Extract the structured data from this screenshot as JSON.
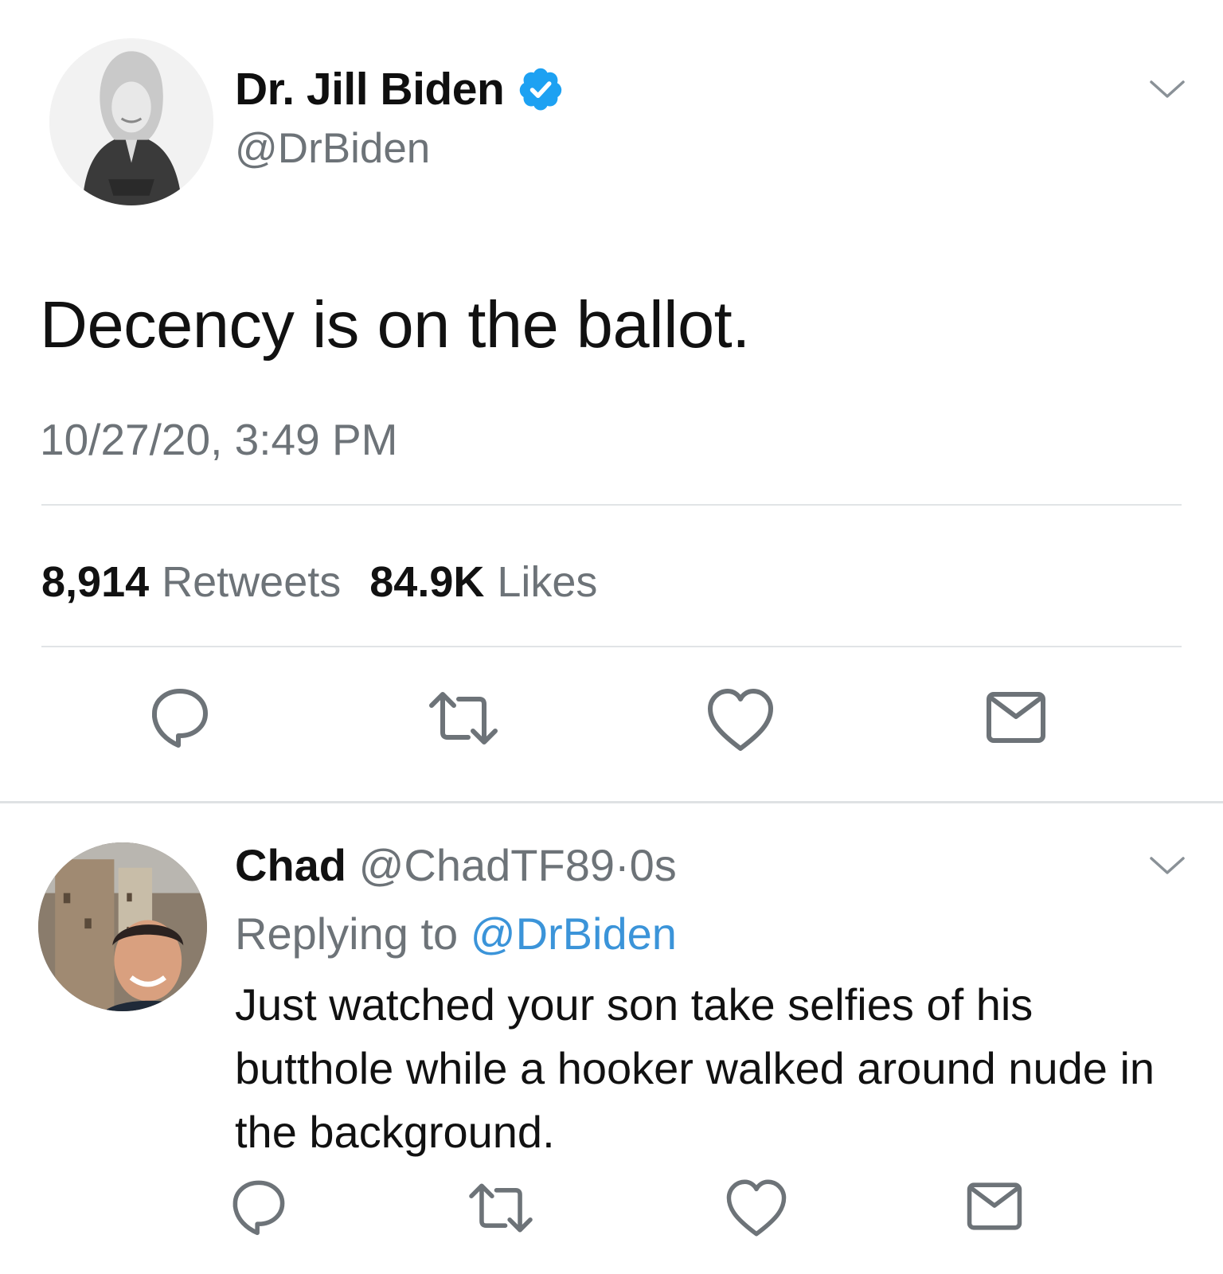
{
  "tweet": {
    "author_name": "Dr. Jill Biden",
    "author_handle": "@DrBiden",
    "verified": true,
    "text": "Decency is on the ballot.",
    "timestamp": "10/27/20, 3:49 PM",
    "retweets_count": "8,914",
    "retweets_label": "Retweets",
    "likes_count": "84.9K",
    "likes_label": "Likes",
    "actions": [
      "reply-icon",
      "retweet-icon",
      "like-icon",
      "message-icon"
    ]
  },
  "reply": {
    "author_name": "Chad",
    "author_handle": "@ChadTF89",
    "separator": "·",
    "time": "0s",
    "replying_prefix": "Replying to",
    "replying_to": "@DrBiden",
    "text": "Just watched your son take selfies of his butthole while a hooker walked around nude in the background.",
    "actions": [
      "reply-icon",
      "retweet-icon",
      "like-icon",
      "message-icon"
    ]
  },
  "colors": {
    "text": "#111111",
    "secondary": "#6d7378",
    "link": "#3b94d9",
    "verified": "#1da1f2",
    "divider": "#e1e4e6"
  }
}
